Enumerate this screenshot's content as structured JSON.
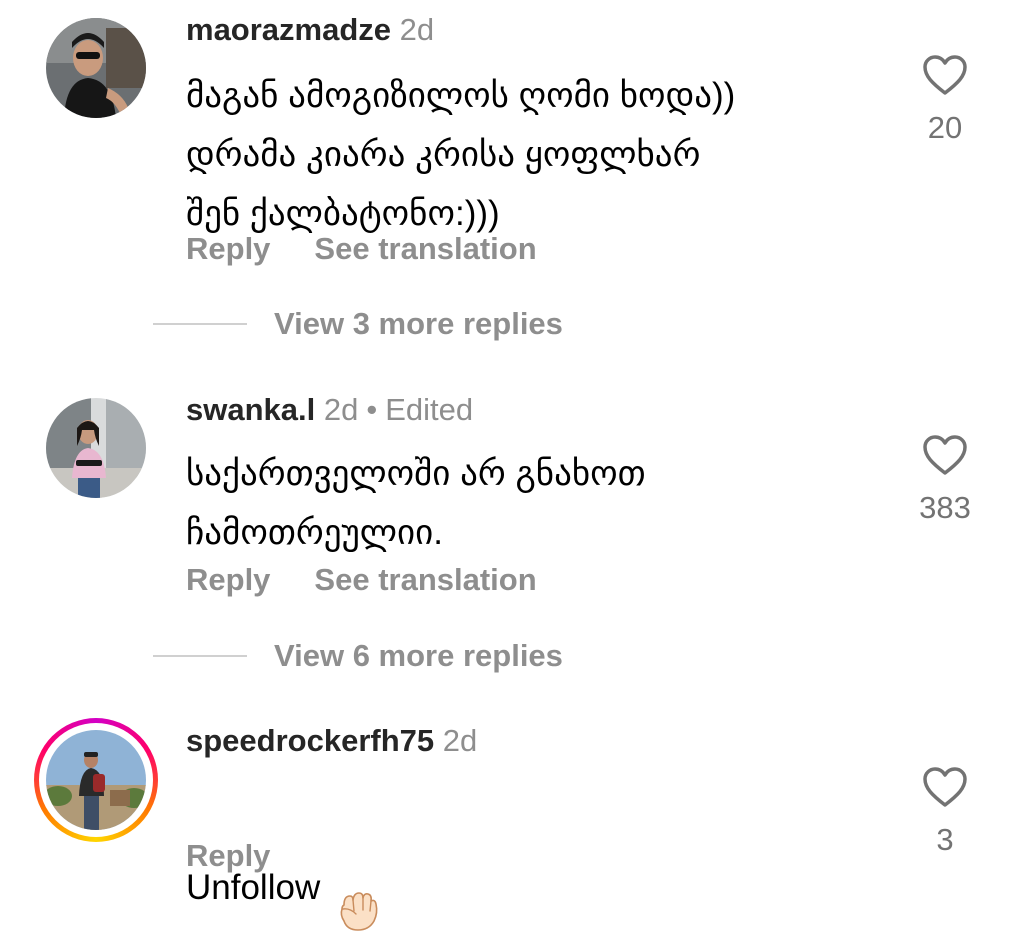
{
  "comments": [
    {
      "username": "maorazmadze",
      "time": "2d",
      "text": "მაგან ამოგიზილოს ღომი ხოდა))\nდრამა კიარა კრისა ყოფლხარ\nშენ ქალბატონო:)))",
      "reply_label": "Reply",
      "translate_label": "See translation",
      "likes": "20",
      "view_more": "View 3 more replies",
      "avatar_icon": "profile-photo"
    },
    {
      "username": "swanka.l",
      "time": "2d",
      "edited": "Edited",
      "text": "საქართველოში არ გნახოთ\nჩამოთრეულიი.",
      "reply_label": "Reply",
      "translate_label": "See translation",
      "likes": "383",
      "view_more": "View 6 more replies",
      "avatar_icon": "profile-photo"
    },
    {
      "username": "speedrockerfh75",
      "time": "2d",
      "text": "Unfollow",
      "emoji": "raised-fist-emoji",
      "reply_label": "Reply",
      "likes": "3",
      "avatar_icon": "profile-photo-with-story-ring",
      "story_ring_colors": [
        "#d300c5",
        "#ff0069",
        "#ff7a00",
        "#ffd600"
      ]
    }
  ],
  "colors": {
    "username": "#262626",
    "secondary": "#8e8e8e",
    "text": "#000000",
    "background": "#ffffff"
  }
}
